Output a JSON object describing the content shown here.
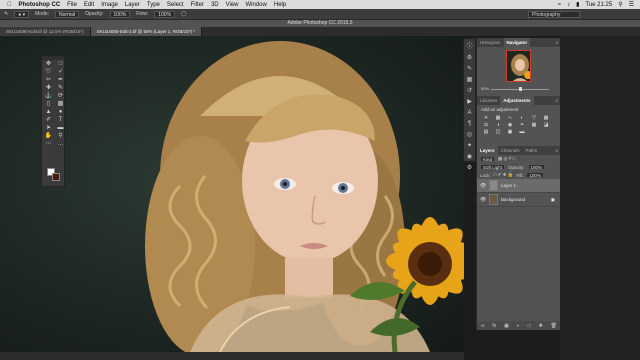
{
  "menubar": {
    "app_name": "Photoshop CC",
    "items": [
      "File",
      "Edit",
      "Image",
      "Layer",
      "Type",
      "Select",
      "Filter",
      "3D",
      "View",
      "Window",
      "Help"
    ],
    "clock": "Tue 21:25"
  },
  "options": {
    "mode_label": "Mode:",
    "mode_value": "Normal",
    "opacity_label": "Opacity:",
    "opacity_value": "100%",
    "flow_label": "Flow:",
    "flow_value": "100%",
    "workspace": "Photography"
  },
  "window_title": "Adobe Photoshop CC 2015.5",
  "doc_tabs": [
    {
      "label": "SKU24080-Edit.tif @ 12.5% (RGB/16*)"
    },
    {
      "label": "SKU24080-Edit-2.tif @ 50% (Layer 1, RGB/16*) *"
    }
  ],
  "panels": {
    "top_tabs": [
      "Histogram",
      "Navigator"
    ],
    "zoom_pct": "50%",
    "adj_tabs": [
      "Libraries",
      "Adjustments"
    ],
    "adj_title": "Add an adjustment",
    "layers_tabs": [
      "Layers",
      "Channels",
      "Paths"
    ],
    "kind_label": "Kind",
    "blend_mode": "Soft Light",
    "opacity_label": "Opacity:",
    "opacity_value": "100%",
    "lock_label": "Lock:",
    "fill_label": "Fill:",
    "fill_value": "100%",
    "layers": [
      {
        "name": "Layer 1",
        "selected": true
      },
      {
        "name": "Background",
        "selected": false
      }
    ]
  },
  "colors": {
    "foreground": "#ffffff",
    "background": "#4a1c10",
    "accent": "#d23a2a"
  }
}
